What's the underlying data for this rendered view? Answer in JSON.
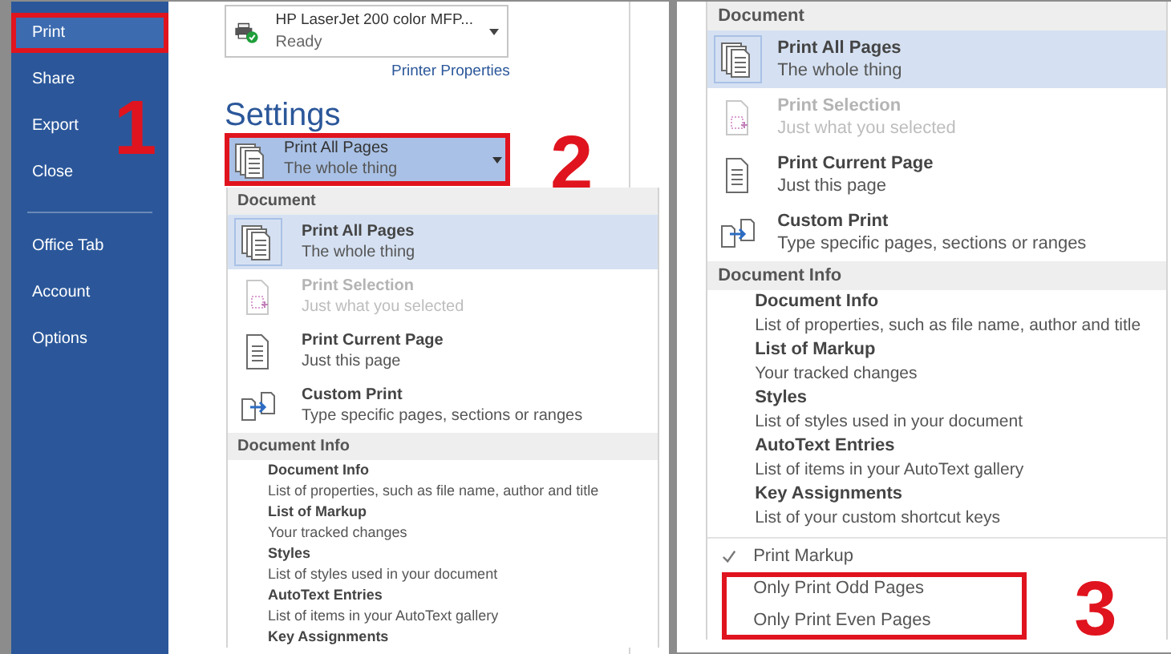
{
  "left_panel": {
    "sidebar": {
      "items": [
        {
          "label": "Print",
          "selected": true,
          "highlighted": true
        },
        {
          "label": "Share",
          "selected": false,
          "highlighted": false
        },
        {
          "label": "Export",
          "selected": false,
          "highlighted": false
        },
        {
          "label": "Close",
          "selected": false,
          "highlighted": false
        },
        {
          "label": "Office Tab",
          "selected": false,
          "highlighted": false
        },
        {
          "label": "Account",
          "selected": false,
          "highlighted": false
        },
        {
          "label": "Options",
          "selected": false,
          "highlighted": false
        }
      ]
    },
    "printer": {
      "name": "HP LaserJet 200 color MFP...",
      "status": "Ready",
      "properties_link": "Printer Properties"
    },
    "settings_heading": "Settings",
    "print_range": {
      "title": "Print All Pages",
      "subtitle": "The whole thing",
      "highlighted": true
    },
    "menu": {
      "sections": [
        {
          "heading": "Document",
          "items": [
            {
              "kind": "pages",
              "title": "Print All Pages",
              "subtitle": "The whole thing",
              "selected": true,
              "disabled": false
            },
            {
              "kind": "selection",
              "title": "Print Selection",
              "subtitle": "Just what you selected",
              "selected": false,
              "disabled": true
            },
            {
              "kind": "page",
              "title": "Print Current Page",
              "subtitle": "Just this page",
              "selected": false,
              "disabled": false
            },
            {
              "kind": "custom",
              "title": "Custom Print",
              "subtitle": "Type specific pages, sections or ranges",
              "selected": false,
              "disabled": false
            }
          ]
        },
        {
          "heading": "Document Info",
          "items": [
            {
              "kind": "text",
              "title": "Document Info",
              "subtitle": "List of properties, such as file name, author and title"
            },
            {
              "kind": "text",
              "title": "List of Markup",
              "subtitle": "Your tracked changes"
            },
            {
              "kind": "text",
              "title": "Styles",
              "subtitle": "List of styles used in your document"
            },
            {
              "kind": "text",
              "title": "AutoText Entries",
              "subtitle": "List of items in your AutoText gallery"
            },
            {
              "kind": "text",
              "title": "Key Assignments"
            }
          ]
        }
      ]
    }
  },
  "right_panel": {
    "menu": {
      "sections": [
        {
          "heading": "Document",
          "items": [
            {
              "kind": "pages",
              "title": "Print All Pages",
              "subtitle": "The whole thing",
              "selected": true,
              "disabled": false
            },
            {
              "kind": "selection",
              "title": "Print Selection",
              "subtitle": "Just what you selected",
              "selected": false,
              "disabled": true
            },
            {
              "kind": "page",
              "title": "Print Current Page",
              "subtitle": "Just this page",
              "selected": false,
              "disabled": false
            },
            {
              "kind": "custom",
              "title": "Custom Print",
              "subtitle": "Type specific pages, sections or ranges",
              "selected": false,
              "disabled": false
            }
          ]
        },
        {
          "heading": "Document Info",
          "items": [
            {
              "kind": "text",
              "title": "Document Info",
              "subtitle": "List of properties, such as file name, author and title"
            },
            {
              "kind": "text",
              "title": "List of Markup",
              "subtitle": "Your tracked changes"
            },
            {
              "kind": "text",
              "title": "Styles",
              "subtitle": "List of styles used in your document"
            },
            {
              "kind": "text",
              "title": "AutoText Entries",
              "subtitle": "List of items in your AutoText gallery"
            },
            {
              "kind": "text",
              "title": "Key Assignments",
              "subtitle": "List of your custom shortcut keys"
            }
          ]
        }
      ]
    },
    "markup": {
      "label": "Print Markup",
      "checked": true
    },
    "page_options": {
      "highlighted": true,
      "items": [
        {
          "label": "Only Print Odd Pages"
        },
        {
          "label": "Only Print Even Pages"
        }
      ]
    }
  },
  "annotations": [
    "1",
    "2",
    "3"
  ]
}
